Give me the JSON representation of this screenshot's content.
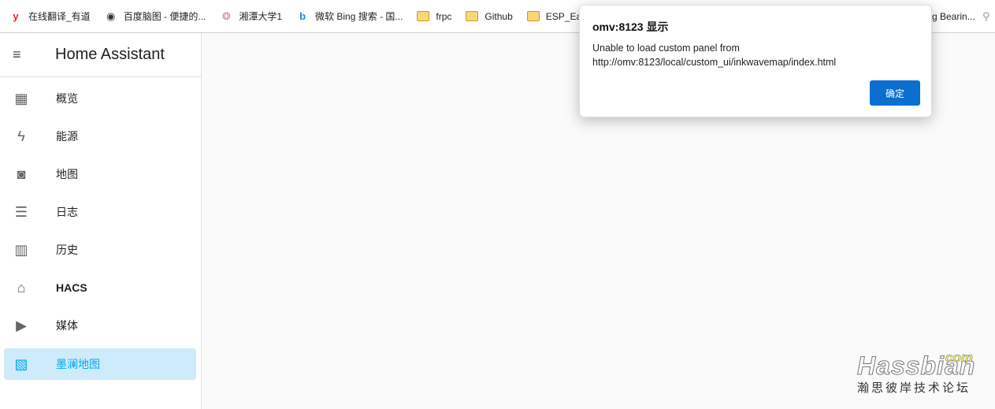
{
  "bookmarks": [
    {
      "label": "在线翻译_有道",
      "icon": "youdao-icon"
    },
    {
      "label": "百度脑图 - 便捷的...",
      "icon": "owl-icon"
    },
    {
      "label": "湘潭大学1",
      "icon": "university-seal-icon"
    },
    {
      "label": "微软 Bing 搜索 - 国...",
      "icon": "bing-icon"
    },
    {
      "label": "frpc",
      "icon": "folder-icon"
    },
    {
      "label": "Github",
      "icon": "folder-icon"
    },
    {
      "label": "ESP_Easy",
      "icon": "folder-icon"
    }
  ],
  "bookmark_overflow": "g Bearin...",
  "sidebar": {
    "title": "Home Assistant",
    "items": [
      {
        "label": "概览",
        "icon": "dashboard-icon"
      },
      {
        "label": "能源",
        "icon": "lightning-icon"
      },
      {
        "label": "地图",
        "icon": "map-pin-icon"
      },
      {
        "label": "日志",
        "icon": "list-icon"
      },
      {
        "label": "历史",
        "icon": "chart-icon"
      },
      {
        "label": "HACS",
        "icon": "store-icon"
      },
      {
        "label": "媒体",
        "icon": "play-icon"
      },
      {
        "label": "墨澜地图",
        "icon": "map-icon",
        "selected": true
      }
    ]
  },
  "dialog": {
    "title": "omv:8123 显示",
    "message": "Unable to load custom panel from http://omv:8123/local/custom_ui/inkwavemap/index.html",
    "ok": "确定"
  },
  "watermark": {
    "brand": "Hassbian",
    "tld": "com",
    "subtitle": "瀚思彼岸技术论坛"
  },
  "colors": {
    "accent": "#03a9f4",
    "selected_bg": "#cdebfa",
    "dialog_button": "#0a6fd0"
  }
}
